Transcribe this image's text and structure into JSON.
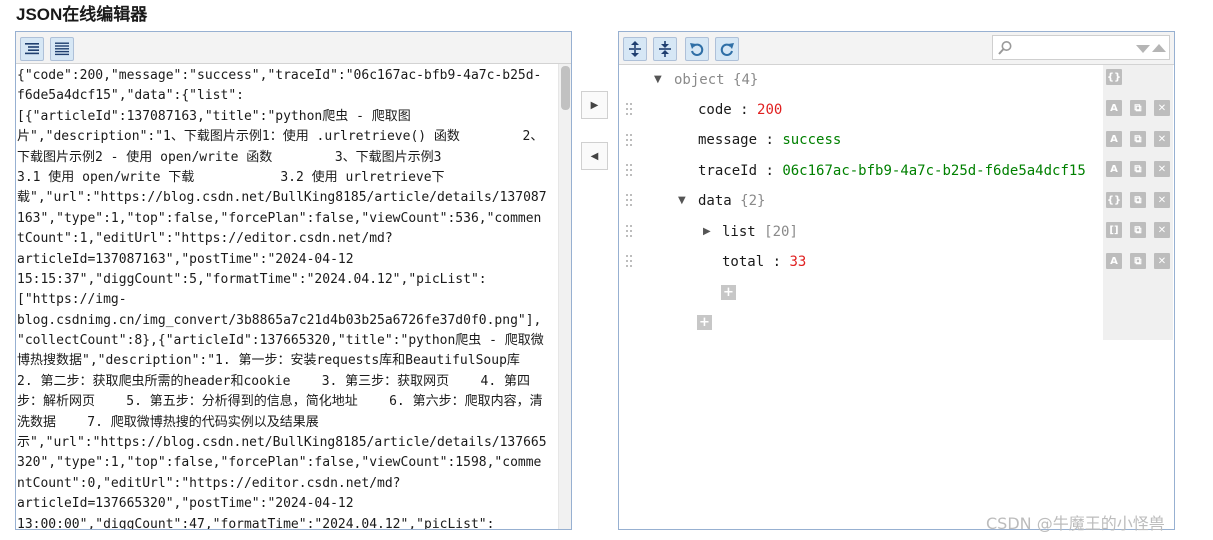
{
  "page_title": "JSON在线编辑器",
  "left_editor": {
    "toolbar": [
      {
        "name": "format-button",
        "icon": "format-indent-icon"
      },
      {
        "name": "compact-button",
        "icon": "compact-lines-icon"
      }
    ],
    "lines": [
      "{\"code\":200,\"message\":\"success\",\"traceId\":\"06c167ac-bfb9-4a7c-b25d-",
      "f6de5a4dcf15\",\"data\":{\"list\":",
      "[{\"articleId\":137087163,\"title\":\"python爬虫 - 爬取图",
      "片\",\"description\":\"1、下载图片示例1：使用 .urlretrieve() 函数        2、",
      "下载图片示例2 - 使用 open/write 函数        3、下载图片示例3",
      "3.1 使用 open/write 下载           3.2 使用 urlretrieve下",
      "载\",\"url\":\"https://blog.csdn.net/BullKing8185/article/details/137087",
      "163\",\"type\":1,\"top\":false,\"forcePlan\":false,\"viewCount\":536,\"commen",
      "tCount\":1,\"editUrl\":\"https://editor.csdn.net/md?",
      "articleId=137087163\",\"postTime\":\"2024-04-12",
      "15:15:37\",\"diggCount\":5,\"formatTime\":\"2024.04.12\",\"picList\":",
      "[\"https://img-",
      "blog.csdnimg.cn/img_convert/3b8865a7c21d4b03b25a6726fe37d0f0.png\"],",
      "\"collectCount\":8},{\"articleId\":137665320,\"title\":\"python爬虫 - 爬取微",
      "博热搜数据\",\"description\":\"1. 第一步：安装requests库和BeautifulSoup库",
      "2. 第二步：获取爬虫所需的header和cookie    3. 第三步：获取网页    4. 第四",
      "步：解析网页    5. 第五步：分析得到的信息，简化地址    6. 第六步：爬取内容，清",
      "洗数据    7. 爬取微博热搜的代码实例以及结果展",
      "示\",\"url\":\"https://blog.csdn.net/BullKing8185/article/details/137665",
      "320\",\"type\":1,\"top\":false,\"forcePlan\":false,\"viewCount\":1598,\"comme",
      "ntCount\":0,\"editUrl\":\"https://editor.csdn.net/md?",
      "articleId=137665320\",\"postTime\":\"2024-04-12",
      "13:00:00\",\"diggCount\":47,\"formatTime\":\"2024.04.12\",\"picList\":"
    ]
  },
  "middle": {
    "to_right_icon": "▶",
    "to_left_icon": "◀"
  },
  "right_tree": {
    "toolbar": [
      {
        "name": "expand-all-button",
        "icon": "expand-all-icon"
      },
      {
        "name": "collapse-all-button",
        "icon": "collapse-all-icon"
      },
      {
        "name": "undo-button",
        "icon": "undo-icon"
      },
      {
        "name": "redo-button",
        "icon": "redo-icon"
      }
    ],
    "search": {
      "value": "",
      "placeholder": ""
    },
    "root": {
      "label": "object",
      "count": "{4}",
      "toggle": "▼"
    },
    "rows": {
      "code": {
        "key": "code",
        "sep": " : ",
        "value": "200"
      },
      "message": {
        "key": "message",
        "sep": " : ",
        "value": "success"
      },
      "traceId": {
        "key": "traceId",
        "sep": " : ",
        "value": "06c167ac-bfb9-4a7c-b25d-f6de5a4dcf15"
      },
      "data": {
        "key": "data",
        "count": "{2}",
        "toggle": "▼"
      },
      "list": {
        "key": "list",
        "count": "[20]",
        "toggle": "▶"
      },
      "total": {
        "key": "total",
        "sep": " : ",
        "value": "33"
      }
    },
    "colors": {
      "number": "#e02020",
      "string": "#008000",
      "meta": "#8a8a8a"
    }
  },
  "watermark": "CSDN @牛魔王的小怪兽"
}
